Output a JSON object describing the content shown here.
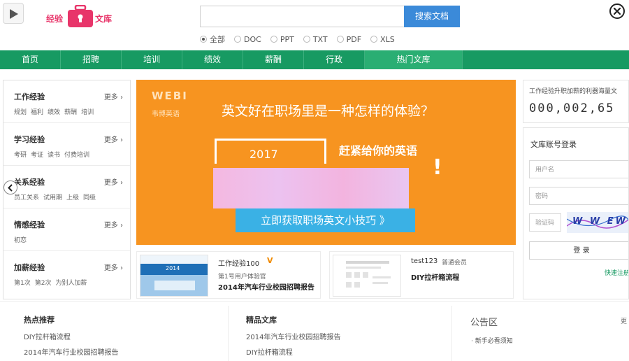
{
  "header": {
    "logo_left": "经验",
    "logo_right": "文库",
    "search_placeholder": "",
    "search_button": "搜索文档",
    "filters": [
      {
        "label": "全部",
        "selected": true
      },
      {
        "label": "DOC",
        "selected": false
      },
      {
        "label": "PPT",
        "selected": false
      },
      {
        "label": "TXT",
        "selected": false
      },
      {
        "label": "PDF",
        "selected": false
      },
      {
        "label": "XLS",
        "selected": false
      }
    ]
  },
  "nav": {
    "items": [
      "首页",
      "招聘",
      "培训",
      "绩效",
      "薪酬",
      "行政",
      "热门文库"
    ],
    "active_index": 6
  },
  "sidebar": {
    "more_label": "更多 ›",
    "categories": [
      {
        "title": "工作经验",
        "tags": [
          "规划",
          "福利",
          "绩效",
          "薪酬",
          "培训"
        ]
      },
      {
        "title": "学习经验",
        "tags": [
          "考研",
          "考证",
          "读书",
          "付费培训"
        ]
      },
      {
        "title": "关系经验",
        "tags": [
          "员工关系",
          "试用期",
          "上级",
          "同级"
        ]
      },
      {
        "title": "情感经验",
        "tags": [
          "初恋"
        ]
      },
      {
        "title": "加薪经验",
        "tags": [
          "第1次",
          "第2次",
          "为别人加薪"
        ]
      }
    ]
  },
  "banner": {
    "brand_en": "WEBI",
    "brand_cn": "韦博英语",
    "headline": "英文好在职场里是一种怎样的体验？",
    "year": "2017",
    "sub_headline": "赶紧给你的英语",
    "exclaim": "!",
    "cta": "立即获取职场英文小技巧 》"
  },
  "docs": [
    {
      "user": "工作经验100",
      "badge": "V",
      "user_sub": "第1号用户体验官",
      "title": "2014年汽车行业校园招聘报告",
      "thumb_label": "2014"
    },
    {
      "user": "test123",
      "user_sub": "普通会员",
      "title": "DIY拉杆箱流程"
    }
  ],
  "promo": {
    "text": "工作经验升职加薪的利器海量文",
    "counter": [
      "0",
      "0",
      "0",
      ",",
      "0",
      "0",
      "2",
      ",",
      "6",
      "5"
    ]
  },
  "login": {
    "title": "文库账号登录",
    "username_placeholder": "用户名",
    "password_placeholder": "密码",
    "captcha_placeholder": "验证码",
    "captcha_text": "W W EW",
    "submit": "登 录",
    "quick_register": "快速注册"
  },
  "bottom": {
    "hot": {
      "title": "热点推荐",
      "links": [
        "DIY拉杆箱流程",
        "2014年汽车行业校园招聘报告"
      ]
    },
    "featured": {
      "title": "精品文库",
      "links": [
        "2014年汽车行业校园招聘报告",
        "DIY拉杆箱流程"
      ]
    },
    "notice": {
      "title": "公告区",
      "more": "更",
      "items": [
        "· 新手必看须知"
      ]
    }
  },
  "colors": {
    "nav_green": "#179a62",
    "banner_orange": "#f79420",
    "search_blue": "#3b8ad9",
    "brand_pink": "#e8356a",
    "cta_blue": "#3ab1e5"
  }
}
